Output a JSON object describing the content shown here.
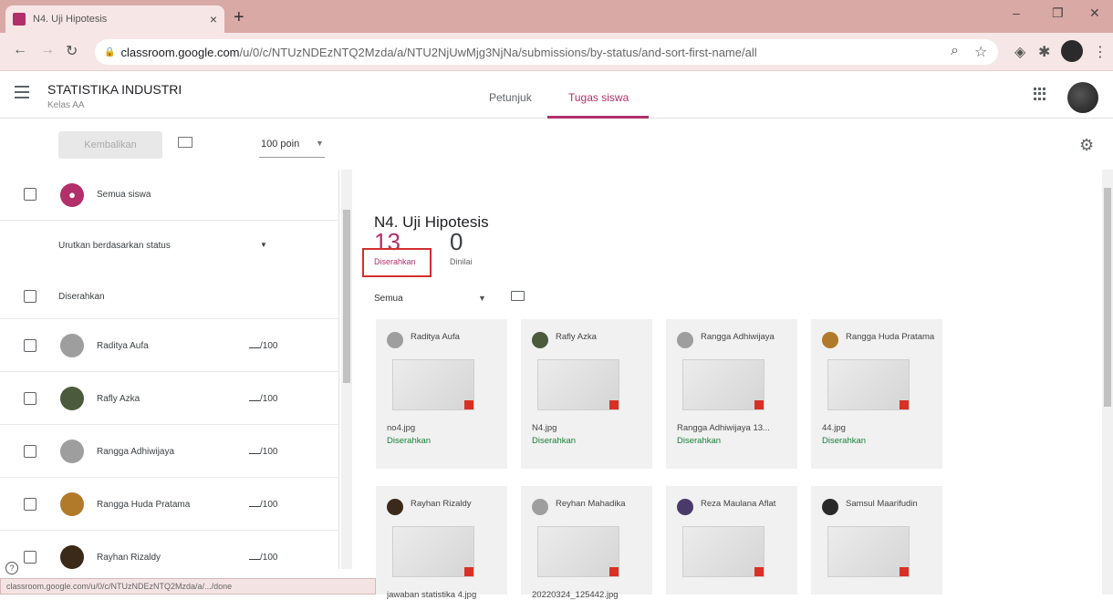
{
  "browser": {
    "tab_title": "N4. Uji Hipotesis",
    "new_tab": "+",
    "url_host": "classroom.google.com",
    "url_path": "/u/0/c/NTUzNDEzNTQ2Mzda/a/NTU2NjUwMjg3NjNa/submissions/by-status/and-sort-first-name/all",
    "status_url": "classroom.google.com/u/0/c/NTUzNDEzNTQ2Mzda/a/.../done"
  },
  "header": {
    "class_name": "STATISTIKA INDUSTRI",
    "class_section": "Kelas AA",
    "tabs": [
      "Petunjuk",
      "Tugas siswa"
    ]
  },
  "toolbar": {
    "return_label": "Kembalikan",
    "points": "100 poin"
  },
  "left": {
    "all_students": "Semua siswa",
    "sort_label": "Urutkan berdasarkan status",
    "section_label": "Diserahkan",
    "students": [
      {
        "name": "Raditya Aufa",
        "grade": "/100",
        "color": "#9e9e9e"
      },
      {
        "name": "Rafly Azka",
        "grade": "/100",
        "color": "#4b5a3c"
      },
      {
        "name": "Rangga Adhiwijaya",
        "grade": "/100",
        "color": "#9e9e9e"
      },
      {
        "name": "Rangga Huda Pratama",
        "grade": "/100",
        "color": "#b07a2a"
      },
      {
        "name": "Rayhan Rizaldy",
        "grade": "/100",
        "color": "#3b2a1a"
      }
    ]
  },
  "main": {
    "title": "N4. Uji Hipotesis",
    "submitted_count": "13",
    "submitted_label": "Diserahkan",
    "graded_count": "0",
    "graded_label": "Dinilai",
    "filter": "Semua",
    "cards": [
      {
        "name": "Raditya Aufa",
        "file": "no4.jpg",
        "status": "Diserahkan",
        "color": "#9e9e9e"
      },
      {
        "name": "Rafly Azka",
        "file": "N4.jpg",
        "status": "Diserahkan",
        "color": "#4b5a3c"
      },
      {
        "name": "Rangga Adhiwijaya",
        "file": "Rangga Adhiwijaya 13...",
        "status": "Diserahkan",
        "color": "#9e9e9e"
      },
      {
        "name": "Rangga Huda Pratama",
        "file": "44.jpg",
        "status": "Diserahkan",
        "color": "#b07a2a"
      },
      {
        "name": "Rayhan Rizaldy",
        "file": "jawaban statistika 4.jpg",
        "status": "",
        "color": "#3b2a1a"
      },
      {
        "name": "Reyhan Mahadika",
        "file": "20220324_125442.jpg",
        "status": "",
        "color": "#9e9e9e"
      },
      {
        "name": "Reza Maulana Aflat",
        "file": "",
        "status": "",
        "color": "#4a3a6a"
      },
      {
        "name": "Samsul Maarifudin",
        "file": "",
        "status": "",
        "color": "#2a2a2a"
      }
    ]
  }
}
